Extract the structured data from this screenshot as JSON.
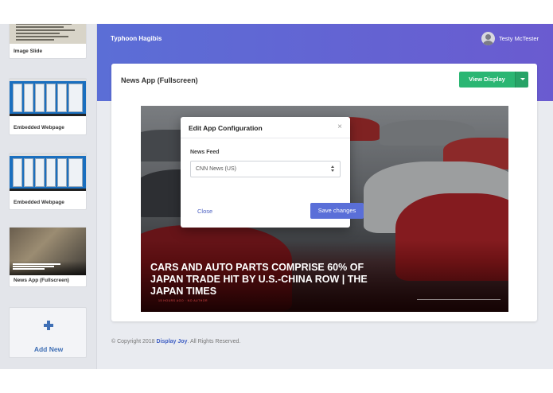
{
  "sidebar": {
    "items": [
      {
        "label": "Image Slide",
        "kind": "document"
      },
      {
        "label": "Embedded Webpage",
        "kind": "webpage"
      },
      {
        "label": "Embedded Webpage",
        "kind": "webpage"
      },
      {
        "label": "News App (Fullscreen)",
        "kind": "news"
      }
    ],
    "add_label": "Add New"
  },
  "header": {
    "workspace": "Typhoon Hagibis",
    "user_name": "Testy McTester"
  },
  "panel": {
    "title": "News App (Fullscreen)",
    "view_button": "View Display"
  },
  "preview": {
    "headline": "CARS AND AUTO PARTS COMPRISE 60% OF JAPAN TRADE HIT BY U.S.-CHINA ROW | THE JAPAN TIMES",
    "byline": "15 HOURS AGO  ·  NO AUTHOR"
  },
  "modal": {
    "title": "Edit App Configuration",
    "close_glyph": "×",
    "field_label": "News Feed",
    "field_value": "CNN News (US)",
    "close_button": "Close",
    "save_button": "Save changes"
  },
  "footer": {
    "prefix": "© Copyright 2018 ",
    "brand": "Display Joy",
    "suffix": ". All Rights Reserved."
  },
  "colors": {
    "accent": "#5a6fd8",
    "success": "#2bb673",
    "header_start": "#5b6ed6",
    "header_end": "#6a5bd0"
  }
}
